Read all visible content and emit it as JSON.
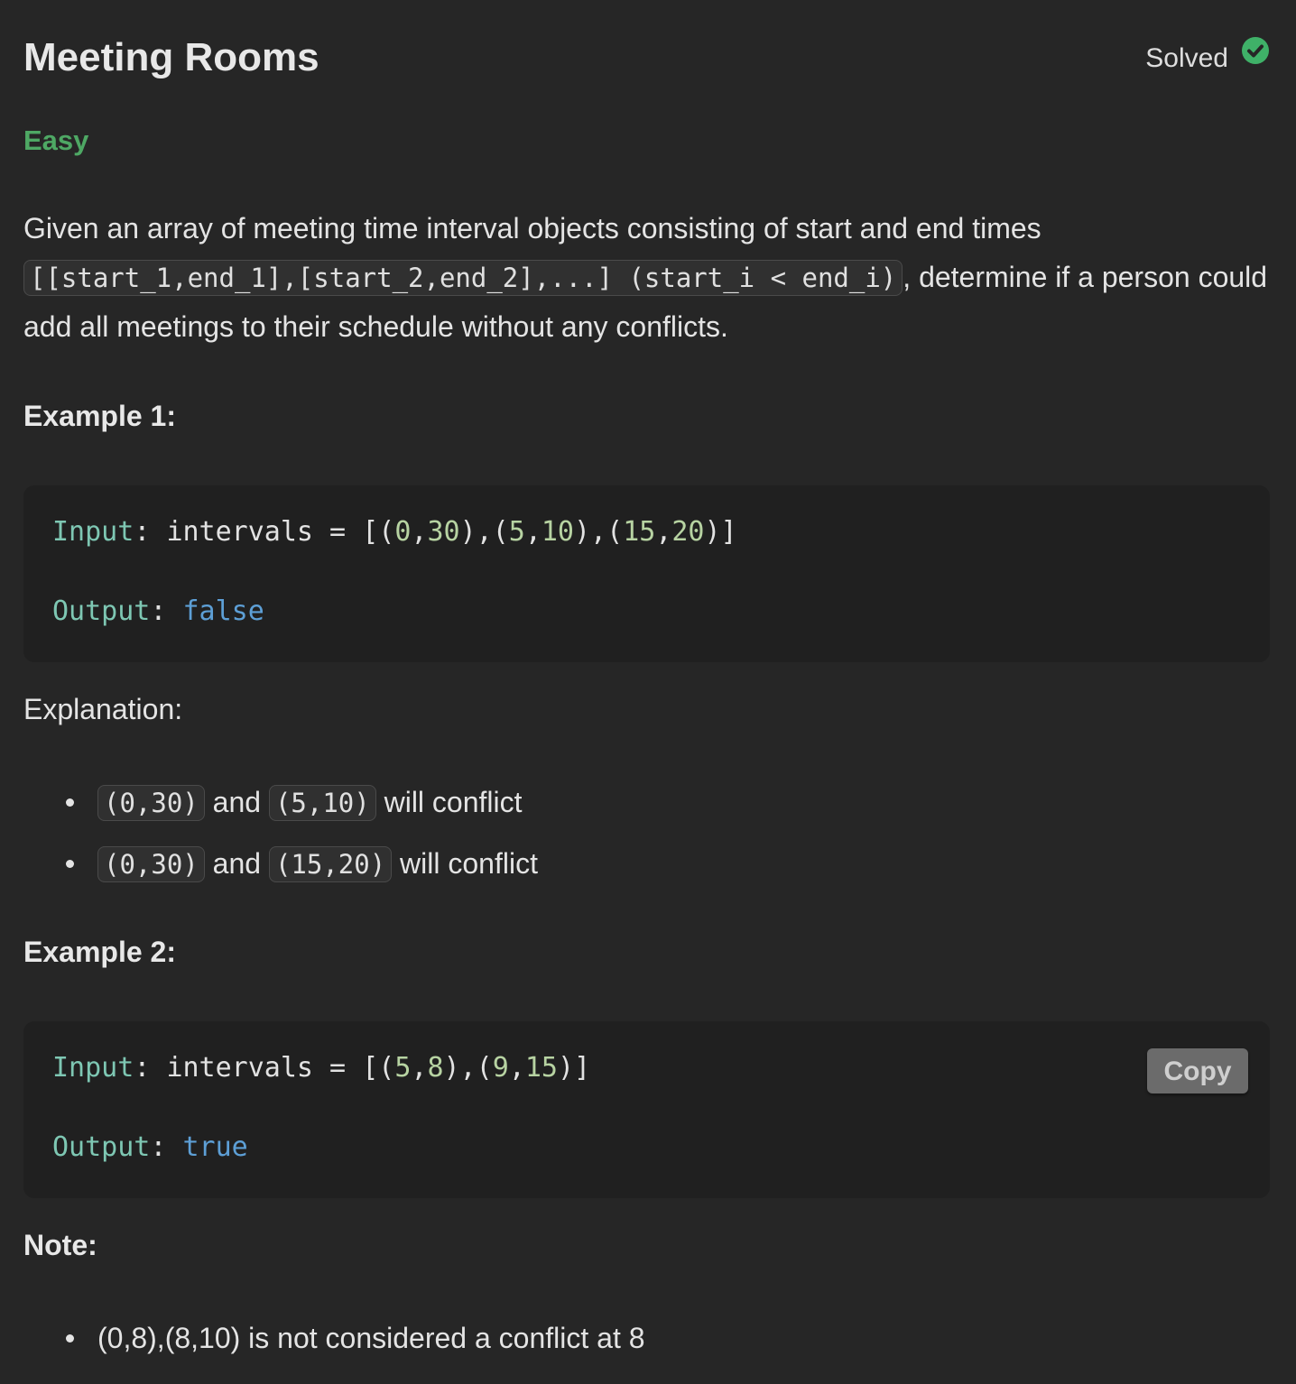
{
  "problem": {
    "title": "Meeting Rooms",
    "status": "Solved",
    "difficulty": "Easy",
    "description": {
      "part1": "Given an array of meeting time interval objects consisting of start and end times ",
      "code": "[[start_1,end_1],[start_2,end_2],...] (start_i < end_i)",
      "part2": ", determine if a person could add all meetings to their schedule without any conflicts."
    }
  },
  "examples": [
    {
      "heading": "Example 1:",
      "input_label": "Input",
      "input_text": "intervals = ",
      "input_value": "[(0,30),(5,10),(15,20)]",
      "output_label": "Output",
      "output_value": "false",
      "explanation_label": "Explanation:",
      "explanation": [
        {
          "a": "(0,30)",
          "mid": " and ",
          "b": "(5,10)",
          "end": " will conflict"
        },
        {
          "a": "(0,30)",
          "mid": " and ",
          "b": "(15,20)",
          "end": " will conflict"
        }
      ]
    },
    {
      "heading": "Example 2:",
      "input_label": "Input",
      "input_text": "intervals = ",
      "input_value": "[(5,8),(9,15)]",
      "output_label": "Output",
      "output_value": "true",
      "copy_label": "Copy"
    }
  ],
  "note": {
    "heading": "Note:",
    "items": [
      "(0,8),(8,10) is not considered a conflict at 8"
    ]
  },
  "colors": {
    "background": "#262626",
    "easy": "#4ea864",
    "solved_check": "#3fb168",
    "keyword": "#7ec7b3",
    "number": "#b7d3a2",
    "boolean": "#5d9fd6"
  }
}
